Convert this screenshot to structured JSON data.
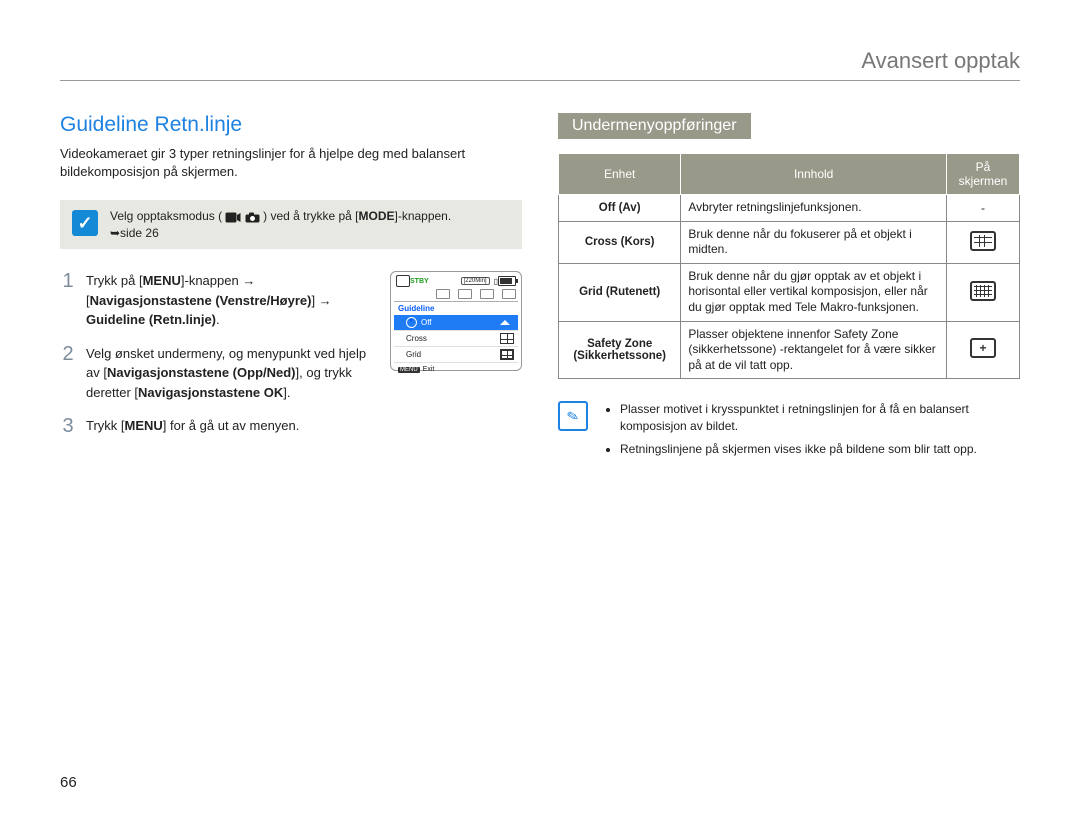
{
  "page_number": "66",
  "header": "Avansert opptak",
  "left": {
    "title": "Guideline Retn.linje",
    "intro": "Videokameraet gir 3 typer retningslinjer for å hjelpe deg med balansert bildekomposisjon på skjermen.",
    "note_prefix": "Velg opptaksmodus (",
    "note_mid": " ) ved å trykke på [",
    "note_mode": "MODE",
    "note_suffix": "]-knappen.",
    "note_page_ref": "➥side 26",
    "steps": [
      {
        "num": "1",
        "parts": {
          "a": "Trykk på [",
          "menu": "MENU",
          "b": "]-knappen ",
          "arrow1": "→",
          "c": " [",
          "nav1": "Navigasjonstastene (Venstre/Høyre)",
          "d": "] ",
          "arrow2": "→",
          "e": " ",
          "target": "Guideline (Retn.linje)",
          "f": "."
        }
      },
      {
        "num": "2",
        "parts": {
          "a": "Velg ønsket undermeny, og menypunkt ved hjelp av [",
          "nav2": "Navigasjonstastene (Opp/Ned)",
          "b": "], og trykk deretter [",
          "nav3": "Navigasjonstastene OK",
          "c": "]."
        }
      },
      {
        "num": "3",
        "parts": {
          "a": "Trykk [",
          "menu": "MENU",
          "b": "] for å gå ut av menyen."
        }
      }
    ],
    "lcd": {
      "stby": "STBY",
      "mins": "[220Min]",
      "title": "Guideline",
      "items": [
        {
          "label": "Off",
          "selected": true,
          "check": true
        },
        {
          "label": "Cross",
          "selected": false,
          "icon": "cross"
        },
        {
          "label": "Grid",
          "selected": false,
          "icon": "grid"
        }
      ],
      "exit_badge": "MENU",
      "exit_label": "Exit"
    }
  },
  "right": {
    "subheader": "Undermenyoppføringer",
    "table": {
      "headers": [
        "Enhet",
        "Innhold",
        "På skjermen"
      ],
      "rows": [
        {
          "name": "Off (Av)",
          "desc": "Avbryter retningslinjefunksjonen.",
          "icon": "-"
        },
        {
          "name": "Cross (Kors)",
          "desc": "Bruk denne når du fokuserer på et objekt i midten.",
          "icon": "cross"
        },
        {
          "name": "Grid (Rutenett)",
          "desc": "Bruk denne når du gjør opptak av et objekt i horisontal eller vertikal komposisjon, eller når du gjør opptak med Tele Makro-funksjonen.",
          "icon": "grid"
        },
        {
          "name": "Safety Zone (Sikkerhetssone)",
          "desc": "Plasser objektene innenfor Safety Zone (sikkerhetssone) -rektangelet for å være sikker på at de vil tatt opp.",
          "icon": "safety"
        }
      ]
    },
    "notes": [
      "Plasser motivet i krysspunktet i retningslinjen for å få en balansert komposisjon av bildet.",
      "Retningslinjene på skjermen vises ikke på bildene som blir tatt opp."
    ]
  }
}
